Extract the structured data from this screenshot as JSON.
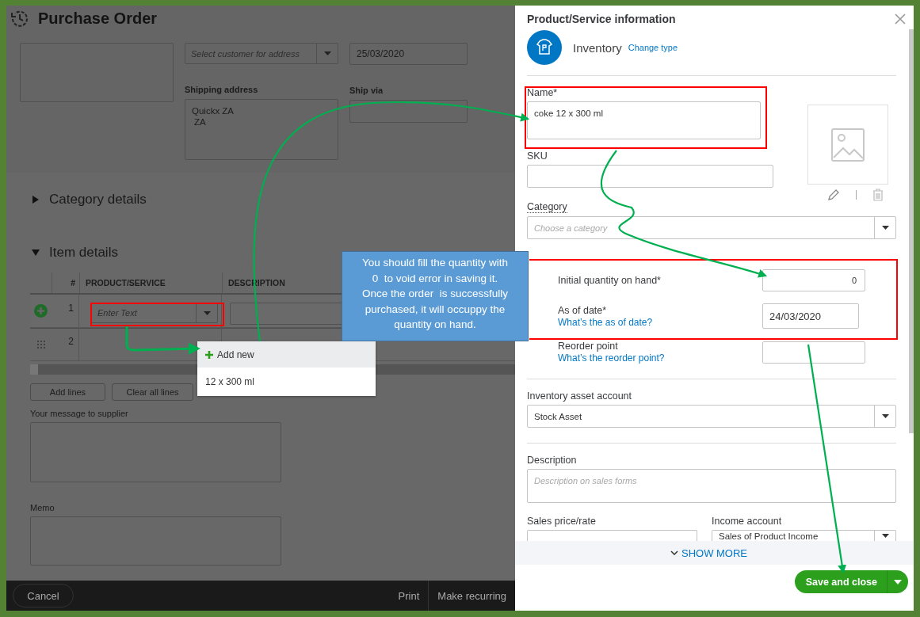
{
  "purchase_order": {
    "title": "Purchase Order",
    "customer_address": {
      "placeholder": "Select customer for address"
    },
    "date": "25/03/2020",
    "shipping_address": {
      "label": "Shipping address",
      "lines": [
        "Quickx ZA",
        "ZA"
      ]
    },
    "ship_via": {
      "label": "Ship via"
    },
    "sections": [
      {
        "label": "Category details",
        "expanded": false
      },
      {
        "label": "Item details",
        "expanded": true
      }
    ],
    "item_table": {
      "columns": [
        "#",
        "PRODUCT/SERVICE",
        "DESCRIPTION"
      ],
      "rows": [
        {
          "number": "1",
          "active": true,
          "product_placeholder": "Enter Text"
        },
        {
          "number": "2",
          "active": false
        }
      ]
    },
    "line_buttons": [
      "Add lines",
      "Clear all lines"
    ],
    "message": {
      "label": "Your message to supplier"
    },
    "memo": {
      "label": "Memo"
    },
    "footer": {
      "cancel": "Cancel",
      "actions": [
        "Print",
        "Make recurring"
      ]
    }
  },
  "product_dropdown": {
    "items": [
      {
        "label": "Add new",
        "kind": "add",
        "highlighted": true
      },
      {
        "label": "12 x 300 ml",
        "kind": "option",
        "highlighted": false
      }
    ]
  },
  "callout": {
    "lines": [
      "You should fill the quantity with",
      "0  to void error in saving it.",
      "Once the order  is successfully",
      "purchased, it will occuppy the",
      "quantity on hand."
    ]
  },
  "drawer": {
    "title": "Product/Service information",
    "type": "Inventory",
    "change_type_link": "Change type",
    "name": {
      "label": "Name*",
      "value": "coke 12 x 300 ml"
    },
    "sku": {
      "label": "SKU"
    },
    "category": {
      "label": "Category",
      "placeholder": "Choose a category"
    },
    "quantity_rows": [
      {
        "label": "Initial quantity on hand*",
        "value": "0"
      },
      {
        "label": "As of date*",
        "help_link": "What’s the as of date?",
        "value": "24/03/2020"
      },
      {
        "label": "Reorder point",
        "help_link": "What’s the reorder point?"
      }
    ],
    "inventory_asset_account": {
      "label": "Inventory asset account",
      "value": "Stock Asset"
    },
    "description": {
      "label": "Description",
      "placeholder": "Description on sales forms"
    },
    "sales_price": {
      "label": "Sales price/rate"
    },
    "income_account": {
      "label": "Income account",
      "value": "Sales of Product Income"
    },
    "show_more": "SHOW MORE",
    "save_button": "Save and close"
  }
}
